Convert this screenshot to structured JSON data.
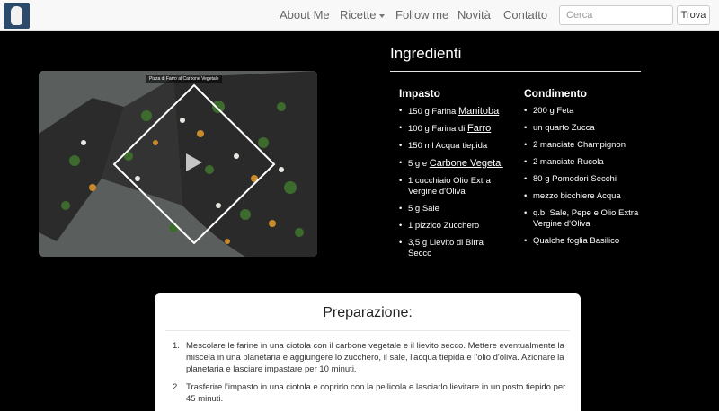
{
  "navbar": {
    "logo_icon": "flask-logo-icon",
    "items": [
      {
        "label": "About Me"
      },
      {
        "label": "Ricette"
      },
      {
        "label": "Follow me"
      },
      {
        "label": "Novità"
      },
      {
        "label": "Contatto"
      }
    ],
    "search_placeholder": "Cerca",
    "search_button": "Trova"
  },
  "video": {
    "title": "Pizza di Farro al Carbone Vegetale",
    "play_icon": "play-icon"
  },
  "ingredients": {
    "title": "Ingredienti",
    "impasto": {
      "title": "Impasto",
      "items": [
        {
          "pre": "150 g Farina ",
          "link": "Manitoba"
        },
        {
          "pre": "100 g Farina di ",
          "link": "Farro"
        },
        {
          "text": "150 ml Acqua tiepida"
        },
        {
          "pre": "5 g e ",
          "link": "Carbone Vegetal"
        },
        {
          "text": "1 cucchiaio Olio Extra Vergine d'Oliva"
        },
        {
          "text": "5 g Sale"
        },
        {
          "text": "1 pizzico Zucchero"
        },
        {
          "text": "3,5 g Lievito di Birra Secco"
        }
      ]
    },
    "condimento": {
      "title": "Condimento",
      "items": [
        {
          "text": "200 g Feta"
        },
        {
          "text": "un quarto Zucca"
        },
        {
          "text": "2 manciate Champignon"
        },
        {
          "text": "2 manciate Rucola"
        },
        {
          "text": "80 g Pomodori Secchi"
        },
        {
          "text": "mezzo bicchiere Acqua"
        },
        {
          "text": "q.b. Sale, Pepe e Olio Extra Vergine d'Oliva"
        },
        {
          "text": "Qualche foglia Basilico"
        }
      ]
    }
  },
  "preparation": {
    "title": "Preparazione:",
    "steps": [
      {
        "num": "1.",
        "text": "Mescolare le farine in una ciotola con il carbone vegetale e il lievito secco. Mettere eventualmente la miscela in una planetaria e aggiungere lo zucchero, il sale, l'acqua tiepida e l'olio d'oliva. Azionare la planetaria e lasciare impastare per 10 minuti."
      },
      {
        "num": "2.",
        "text": "Trasferire l'impasto in una ciotola e coprirlo con la pellicola e lasciarlo lievitare in un posto tiepido per 45 minuti."
      }
    ]
  }
}
